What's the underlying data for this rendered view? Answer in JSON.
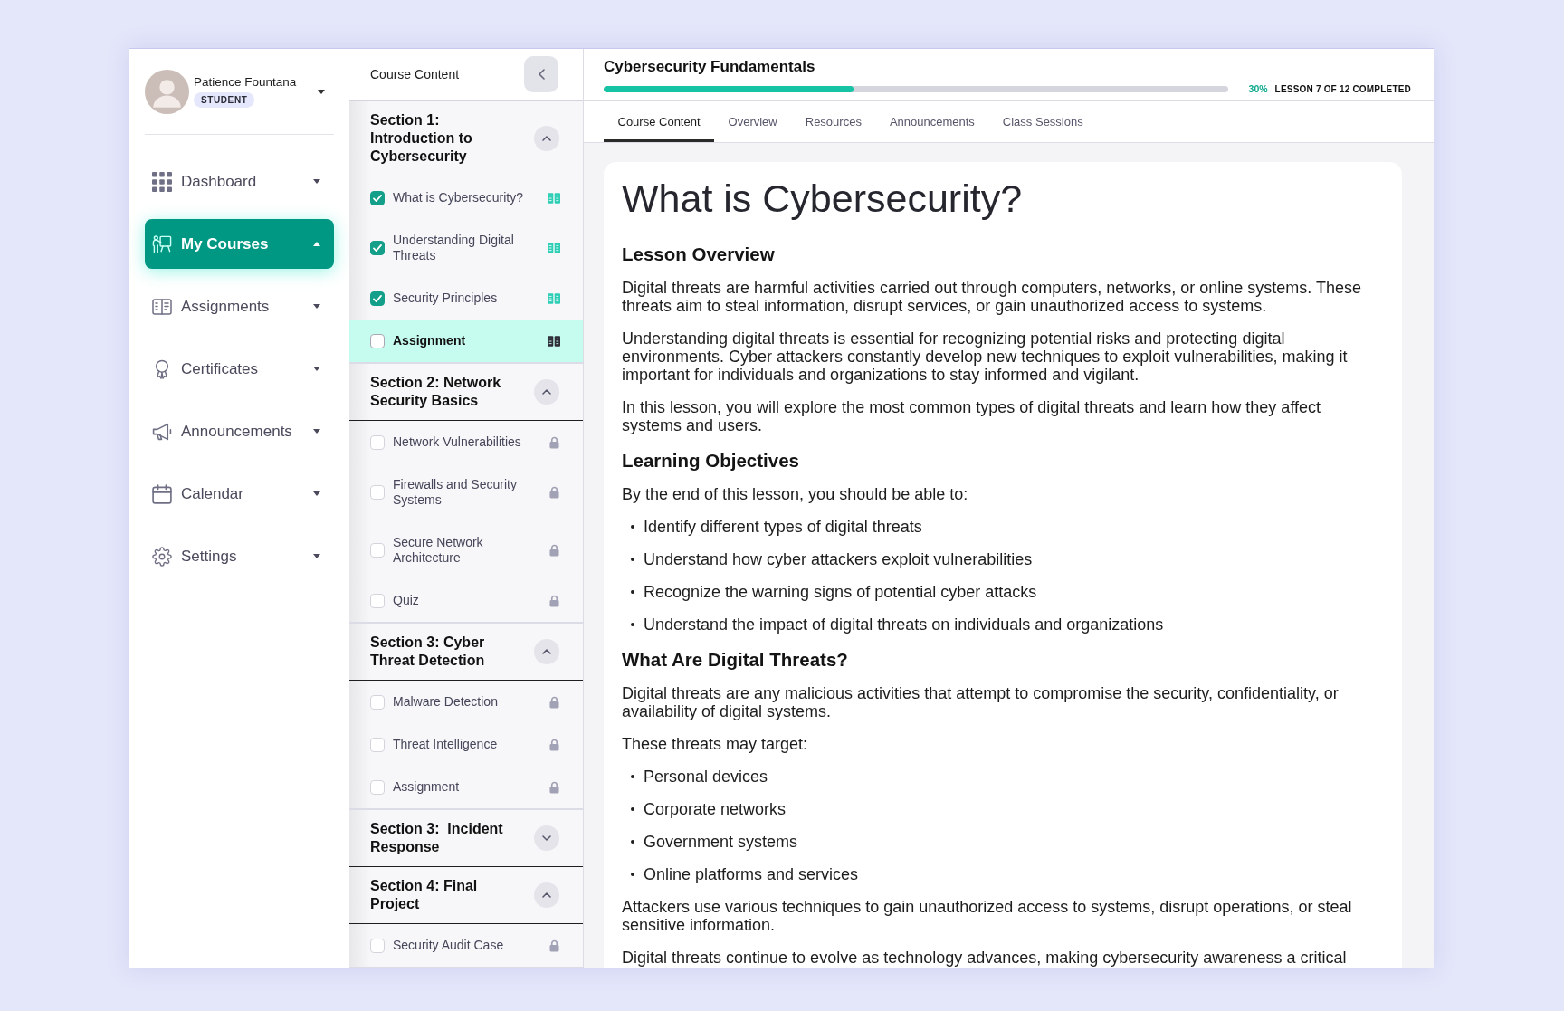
{
  "profile": {
    "name": "Patience Fountana",
    "role": "STUDENT"
  },
  "nav": [
    {
      "label": "Dashboard",
      "selected": false,
      "expanded": false
    },
    {
      "label": "My Courses",
      "selected": true,
      "expanded": true
    },
    {
      "label": "Assignments",
      "selected": false,
      "expanded": false
    },
    {
      "label": "Certificates",
      "selected": false,
      "expanded": false
    },
    {
      "label": "Announcements",
      "selected": false,
      "expanded": false
    },
    {
      "label": "Calendar",
      "selected": false,
      "expanded": false
    },
    {
      "label": "Settings",
      "selected": false,
      "expanded": false
    }
  ],
  "course_panel": {
    "title": "Course Content",
    "sections": [
      {
        "title": "Section 1: Introduction to Cybersecurity",
        "expanded": true,
        "lessons": [
          {
            "title": "What is Cybersecurity?",
            "checked": true,
            "locked": false,
            "selected": false
          },
          {
            "title": "Understanding Digital Threats",
            "checked": true,
            "locked": false,
            "selected": false
          },
          {
            "title": "Security Principles",
            "checked": true,
            "locked": false,
            "selected": false
          },
          {
            "title": "Assignment",
            "checked": false,
            "locked": false,
            "selected": true
          }
        ]
      },
      {
        "title": "Section 2: Network Security Basics",
        "expanded": true,
        "lessons": [
          {
            "title": "Network Vulnerabilities",
            "checked": false,
            "locked": true,
            "selected": false
          },
          {
            "title": "Firewalls and Security Systems",
            "checked": false,
            "locked": true,
            "selected": false
          },
          {
            "title": "Secure Network Architecture",
            "checked": false,
            "locked": true,
            "selected": false
          },
          {
            "title": "Quiz",
            "checked": false,
            "locked": true,
            "selected": false
          }
        ]
      },
      {
        "title": "Section 3: Cyber Threat Detection",
        "expanded": true,
        "lessons": [
          {
            "title": "Malware Detection",
            "checked": false,
            "locked": true,
            "selected": false
          },
          {
            "title": "Threat Intelligence",
            "checked": false,
            "locked": true,
            "selected": false
          },
          {
            "title": "Assignment",
            "checked": false,
            "locked": true,
            "selected": false
          }
        ]
      },
      {
        "title": "Section 3:  Incident Response",
        "expanded": false
      },
      {
        "title": "Section 4: Final Project",
        "expanded": true,
        "lessons": [
          {
            "title": "Security Audit Case",
            "checked": false,
            "locked": true,
            "selected": false
          }
        ]
      }
    ]
  },
  "course": {
    "title": "Cybersecurity Fundamentals",
    "progress": {
      "level": 0.4,
      "percent": "30%",
      "caption": "LESSON 7 OF 12 COMPLETED"
    }
  },
  "tabs": [
    {
      "label": "Course Content",
      "selected": true
    },
    {
      "label": "Overview",
      "selected": false
    },
    {
      "label": "Resources",
      "selected": false
    },
    {
      "label": "Announcements",
      "selected": false
    },
    {
      "label": "Class Sessions",
      "selected": false
    }
  ],
  "lesson": {
    "title": "What is Cybersecurity?",
    "blocks": [
      {
        "kind": "heading",
        "text": "Lesson Overview"
      },
      {
        "kind": "paragraph",
        "text": "Digital threats are harmful activities carried out through computers, networks, or online systems. These threats aim to steal information, disrupt services, or gain unauthorized access to systems."
      },
      {
        "kind": "paragraph",
        "text": "Understanding digital threats is essential for recognizing potential risks and protecting digital environments. Cyber attackers constantly develop new techniques to exploit vulnerabilities, making it important for individuals and organizations to stay informed and vigilant."
      },
      {
        "kind": "paragraph",
        "text": "In this lesson, you will explore the most common types of digital threats and learn how they affect systems and users."
      },
      {
        "kind": "heading",
        "text": "Learning Objectives"
      },
      {
        "kind": "paragraph",
        "text": "By the end of this lesson, you should be able to:"
      },
      {
        "kind": "list",
        "items": [
          "Identify different types of digital threats",
          "Understand how cyber attackers exploit vulnerabilities",
          "Recognize the warning signs of potential cyber attacks",
          "Understand the impact of digital threats on individuals and organizations"
        ]
      },
      {
        "kind": "heading",
        "text": "What Are Digital Threats?"
      },
      {
        "kind": "paragraph",
        "text": "Digital threats are any malicious activities that attempt to compromise the security, confidentiality, or availability of digital systems."
      },
      {
        "kind": "paragraph",
        "text": "These threats may target:"
      },
      {
        "kind": "list",
        "items": [
          "Personal devices",
          "Corporate networks",
          "Government systems",
          "Online platforms and services"
        ]
      },
      {
        "kind": "paragraph",
        "text": "Attackers use various techniques to gain unauthorized access to systems, disrupt operations, or steal sensitive information."
      },
      {
        "kind": "paragraph",
        "text": "Digital threats continue to evolve as technology advances, making cybersecurity awareness a critical"
      }
    ]
  }
}
